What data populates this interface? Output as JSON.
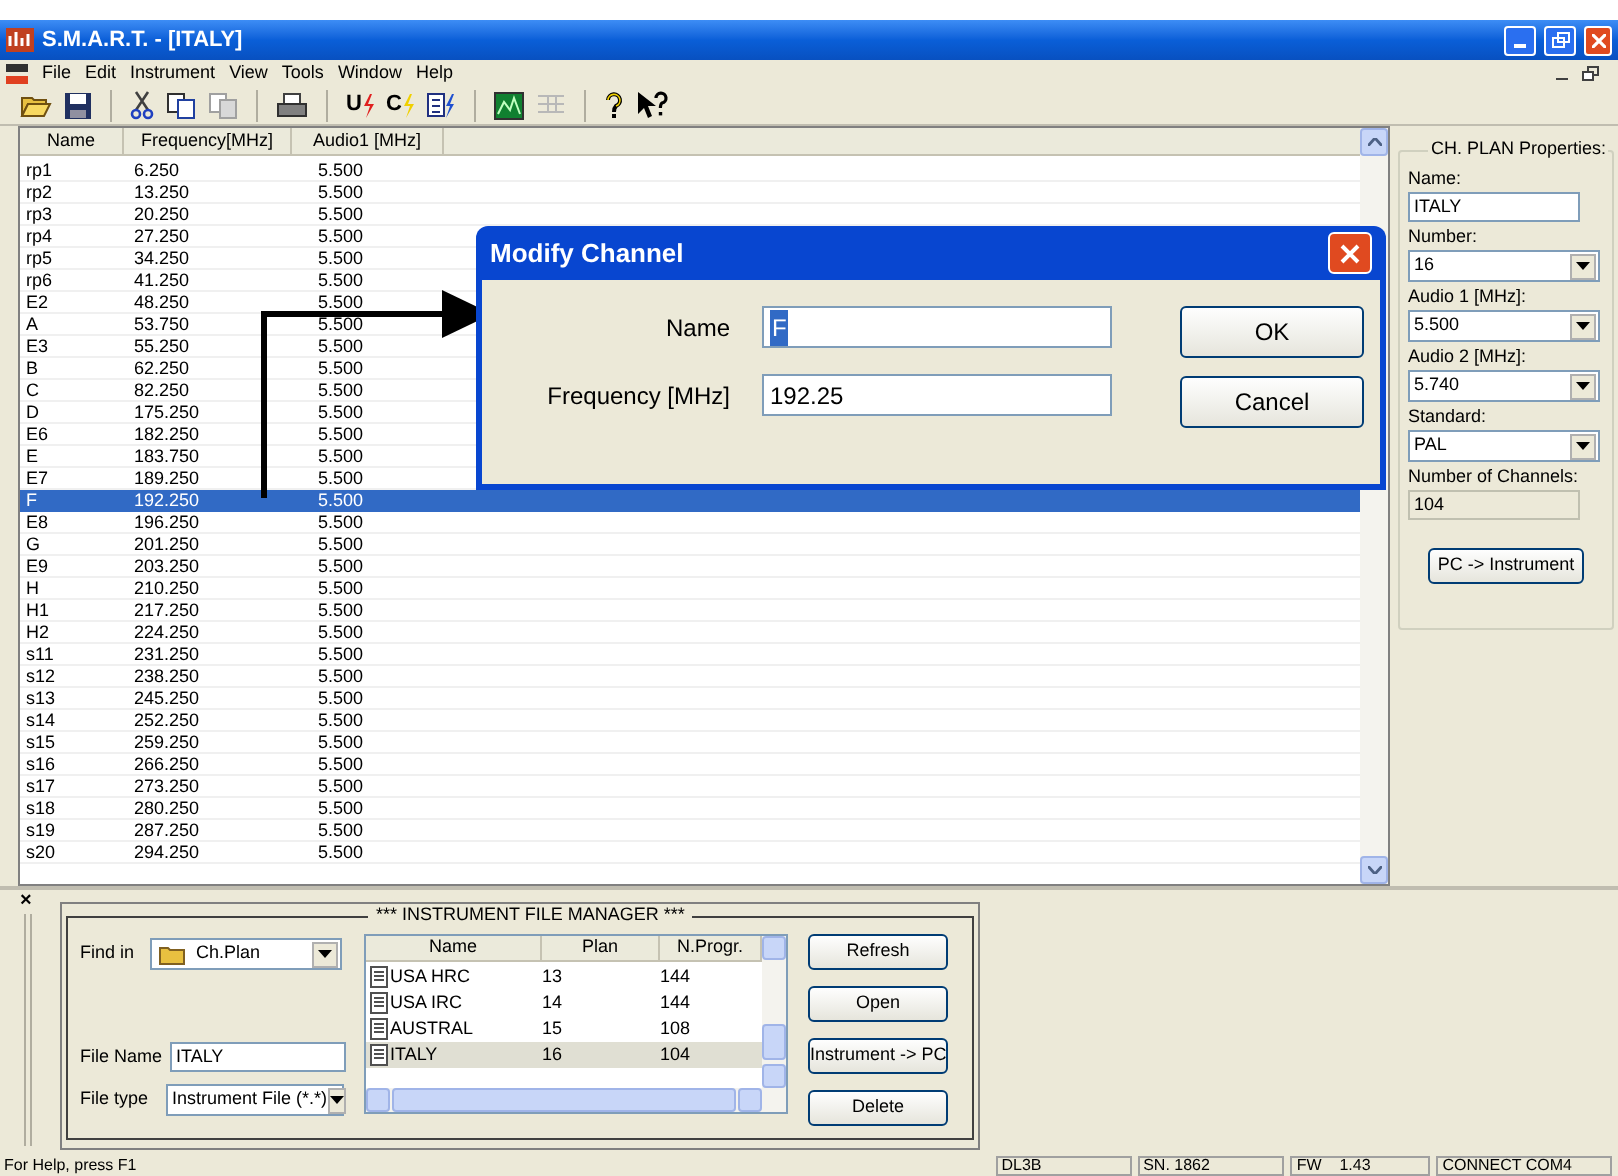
{
  "window": {
    "title": "S.M.A.R.T. - [ITALY]",
    "menu": [
      "File",
      "Edit",
      "Instrument",
      "View",
      "Tools",
      "Window",
      "Help"
    ]
  },
  "toolbar": [
    {
      "kind": "open",
      "disabled": false
    },
    {
      "kind": "save",
      "disabled": false
    },
    {
      "kind": "sep"
    },
    {
      "kind": "cut",
      "disabled": false
    },
    {
      "kind": "copy",
      "disabled": false
    },
    {
      "kind": "paste",
      "disabled": true
    },
    {
      "kind": "sep"
    },
    {
      "kind": "print",
      "disabled": false
    },
    {
      "kind": "sep"
    },
    {
      "kind": "letter",
      "label": "U",
      "color": "#e02020",
      "disabled": false
    },
    {
      "kind": "letter",
      "label": "C",
      "color": "#f0d000",
      "disabled": false
    },
    {
      "kind": "doc-bolt",
      "disabled": false
    },
    {
      "kind": "sep"
    },
    {
      "kind": "chart",
      "disabled": false
    },
    {
      "kind": "grid",
      "disabled": true
    },
    {
      "kind": "sep"
    },
    {
      "kind": "help",
      "disabled": false
    },
    {
      "kind": "context-help",
      "disabled": false
    }
  ],
  "channel_list": {
    "columns": [
      "Name",
      "Frequency[MHz]",
      "Audio1 [MHz]"
    ],
    "rows": [
      {
        "name": "rp1",
        "frequency": "6.250",
        "audio1": "5.500",
        "selected": false
      },
      {
        "name": "rp2",
        "frequency": "13.250",
        "audio1": "5.500",
        "selected": false
      },
      {
        "name": "rp3",
        "frequency": "20.250",
        "audio1": "5.500",
        "selected": false
      },
      {
        "name": "rp4",
        "frequency": "27.250",
        "audio1": "5.500",
        "selected": false
      },
      {
        "name": "rp5",
        "frequency": "34.250",
        "audio1": "5.500",
        "selected": false
      },
      {
        "name": "rp6",
        "frequency": "41.250",
        "audio1": "5.500",
        "selected": false
      },
      {
        "name": "E2",
        "frequency": "48.250",
        "audio1": "5.500",
        "selected": false
      },
      {
        "name": "A",
        "frequency": "53.750",
        "audio1": "5.500",
        "selected": false
      },
      {
        "name": "E3",
        "frequency": "55.250",
        "audio1": "5.500",
        "selected": false
      },
      {
        "name": "B",
        "frequency": "62.250",
        "audio1": "5.500",
        "selected": false
      },
      {
        "name": "C",
        "frequency": "82.250",
        "audio1": "5.500",
        "selected": false
      },
      {
        "name": "D",
        "frequency": "175.250",
        "audio1": "5.500",
        "selected": false
      },
      {
        "name": "E6",
        "frequency": "182.250",
        "audio1": "5.500",
        "selected": false
      },
      {
        "name": "E",
        "frequency": "183.750",
        "audio1": "5.500",
        "selected": false
      },
      {
        "name": "E7",
        "frequency": "189.250",
        "audio1": "5.500",
        "selected": false
      },
      {
        "name": "F",
        "frequency": "192.250",
        "audio1": "5.500",
        "selected": true
      },
      {
        "name": "E8",
        "frequency": "196.250",
        "audio1": "5.500",
        "selected": false
      },
      {
        "name": "G",
        "frequency": "201.250",
        "audio1": "5.500",
        "selected": false
      },
      {
        "name": "E9",
        "frequency": "203.250",
        "audio1": "5.500",
        "selected": false
      },
      {
        "name": "H",
        "frequency": "210.250",
        "audio1": "5.500",
        "selected": false
      },
      {
        "name": "H1",
        "frequency": "217.250",
        "audio1": "5.500",
        "selected": false
      },
      {
        "name": "H2",
        "frequency": "224.250",
        "audio1": "5.500",
        "selected": false
      },
      {
        "name": "s11",
        "frequency": "231.250",
        "audio1": "5.500",
        "selected": false
      },
      {
        "name": "s12",
        "frequency": "238.250",
        "audio1": "5.500",
        "selected": false
      },
      {
        "name": "s13",
        "frequency": "245.250",
        "audio1": "5.500",
        "selected": false
      },
      {
        "name": "s14",
        "frequency": "252.250",
        "audio1": "5.500",
        "selected": false
      },
      {
        "name": "s15",
        "frequency": "259.250",
        "audio1": "5.500",
        "selected": false
      },
      {
        "name": "s16",
        "frequency": "266.250",
        "audio1": "5.500",
        "selected": false
      },
      {
        "name": "s17",
        "frequency": "273.250",
        "audio1": "5.500",
        "selected": false
      },
      {
        "name": "s18",
        "frequency": "280.250",
        "audio1": "5.500",
        "selected": false
      },
      {
        "name": "s19",
        "frequency": "287.250",
        "audio1": "5.500",
        "selected": false
      },
      {
        "name": "s20",
        "frequency": "294.250",
        "audio1": "5.500",
        "selected": false
      }
    ]
  },
  "dialog": {
    "title": "Modify Channel",
    "name_label": "Name",
    "name_value": "F",
    "name_highlighted": true,
    "frequency_label": "Frequency [MHz]",
    "frequency_value": "192.25",
    "buttons": [
      "OK",
      "Cancel"
    ]
  },
  "properties": {
    "title": "CH. PLAN Properties:",
    "fields": [
      {
        "label": "Name:",
        "value": "ITALY",
        "kind": "text"
      },
      {
        "label": "Number:",
        "value": "16",
        "kind": "combo"
      },
      {
        "label": "Audio 1 [MHz]:",
        "value": "5.500",
        "kind": "combo"
      },
      {
        "label": "Audio 2 [MHz]:",
        "value": "5.740",
        "kind": "combo"
      },
      {
        "label": "Standard:",
        "value": "PAL",
        "kind": "combo"
      },
      {
        "label": "Number of Channels:",
        "value": "104",
        "kind": "readonly"
      }
    ],
    "button": "PC -> Instrument"
  },
  "file_manager": {
    "close": "×",
    "title": "***  INSTRUMENT FILE MANAGER  ***",
    "find_in_label": "Find in",
    "find_in_value": "Ch.Plan",
    "file_name_label": "File Name",
    "file_name_value": "ITALY",
    "file_type_label": "File type",
    "file_type_value": "Instrument File (*.*)",
    "columns": [
      "Name",
      "Plan",
      "N.Progr."
    ],
    "files": [
      {
        "name": "USA HRC",
        "plan": "13",
        "nprogr": "144",
        "selected": false
      },
      {
        "name": "USA IRC",
        "plan": "14",
        "nprogr": "144",
        "selected": false
      },
      {
        "name": "AUSTRAL",
        "plan": "15",
        "nprogr": "108",
        "selected": false
      },
      {
        "name": "ITALY",
        "plan": "16",
        "nprogr": "104",
        "selected": true
      }
    ],
    "buttons": [
      "Refresh",
      "Open",
      "Instrument -> PC",
      "Delete"
    ]
  },
  "status_bar": {
    "help": "For Help, press F1",
    "panes": [
      "DL3B",
      "SN. 1862",
      "FW    1.43",
      "CONNECT COM4"
    ]
  }
}
